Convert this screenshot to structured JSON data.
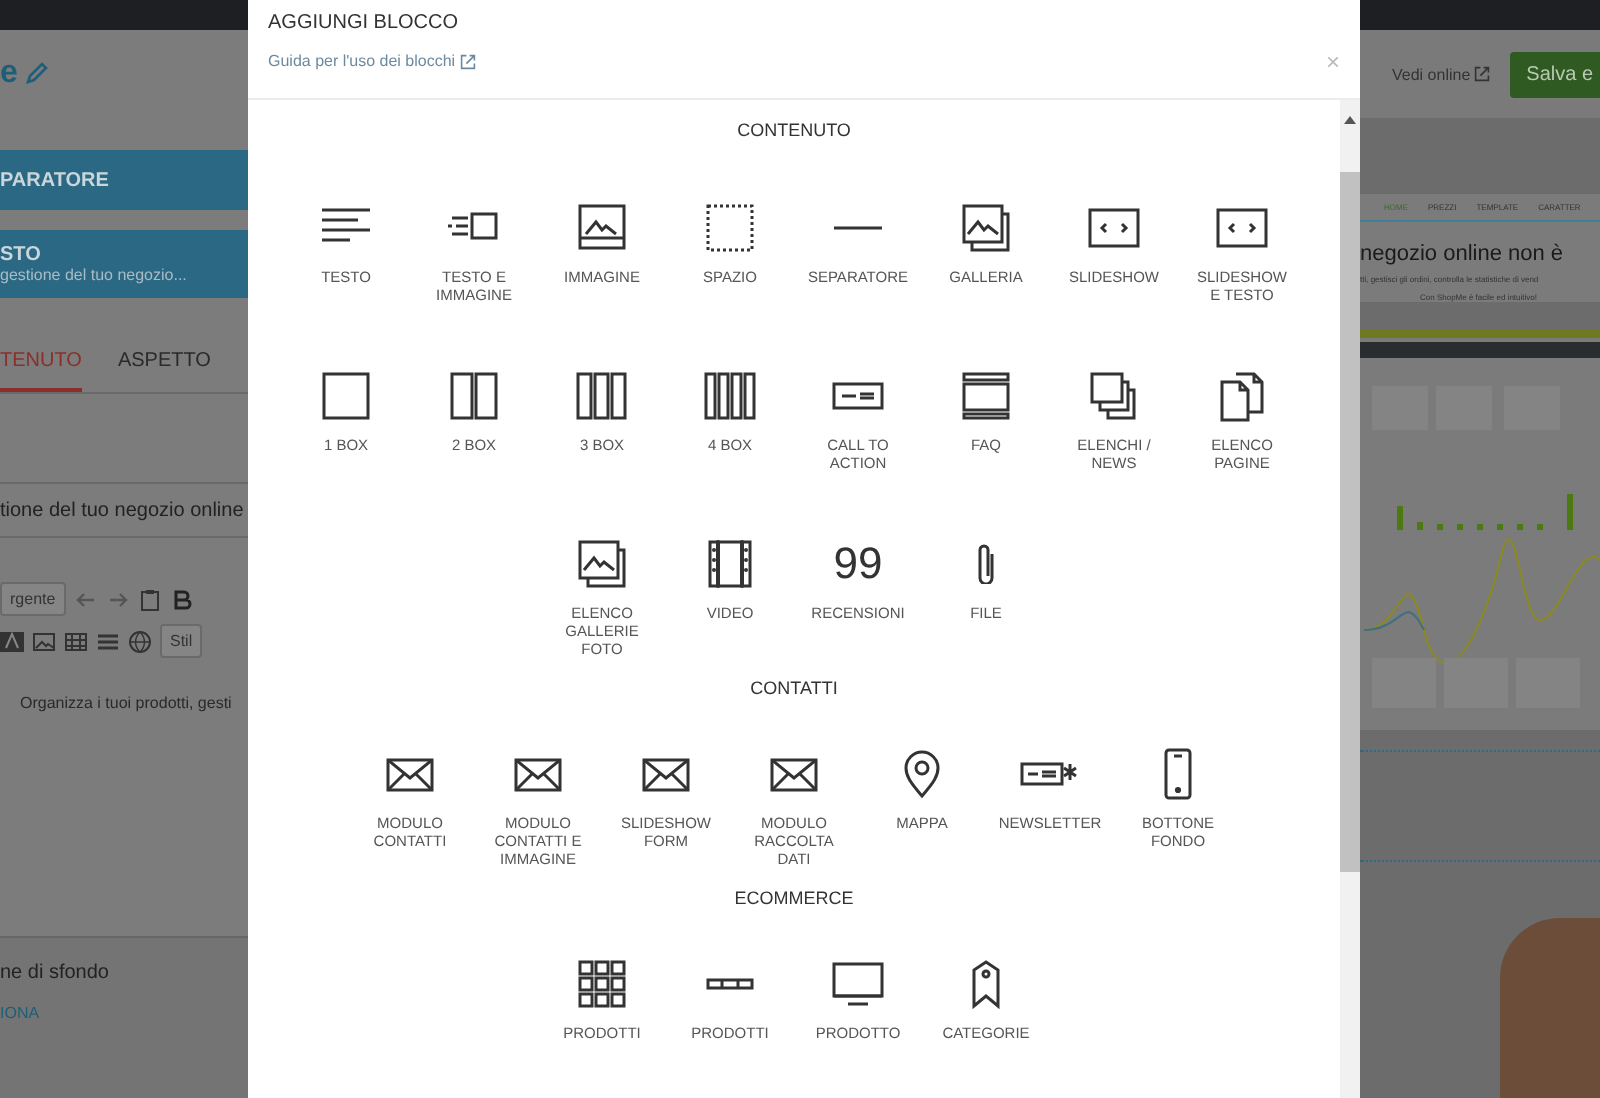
{
  "editor": {
    "title_fragment": "e",
    "blocks": [
      {
        "title": "PARATORE"
      },
      {
        "title": "STO",
        "subtitle": "gestione del tuo negozio..."
      }
    ],
    "tabs": [
      {
        "label": "TENUTO",
        "selected": true
      },
      {
        "label": "ASPETTO",
        "selected": false
      }
    ],
    "title_field": {
      "value": "tione del tuo negozio online"
    },
    "toolbar": {
      "source_button": "rgente",
      "style_select": "Stil"
    },
    "body_text": "Organizza i tuoi prodotti, gesti",
    "background_label": "ne di sfondo",
    "background_link": "IONA"
  },
  "header_actions": {
    "view_online": "Vedi online",
    "save": "Salva e"
  },
  "preview": {
    "nav": [
      "HOME",
      "PREZZI",
      "TEMPLATE",
      "CARATTER"
    ],
    "heading": "negozio online non è",
    "line_1": "tti, gestisci gli ordini, controlla le statistiche di vend",
    "line_2": "Con ShopMe è facile ed intuitivo!"
  },
  "modal": {
    "title": "AGGIUNGI BLOCCO",
    "guide_link": "Guida per l'uso dei blocchi",
    "close": "×",
    "sections": [
      {
        "title": "CONTENUTO",
        "items": [
          {
            "kind": "text",
            "label": "TESTO"
          },
          {
            "kind": "text-image",
            "label": "TESTO E IMMAGINE"
          },
          {
            "kind": "image",
            "label": "IMMAGINE"
          },
          {
            "kind": "space",
            "label": "SPAZIO"
          },
          {
            "kind": "separator",
            "label": "SEPARATORE"
          },
          {
            "kind": "gallery",
            "label": "GALLERIA"
          },
          {
            "kind": "slideshow",
            "label": "SLIDESHOW"
          },
          {
            "kind": "slideshow",
            "label": "SLIDESHOW E TESTO"
          },
          {
            "kind": "box1",
            "label": "1 BOX"
          },
          {
            "kind": "box2",
            "label": "2 BOX"
          },
          {
            "kind": "box3",
            "label": "3 BOX"
          },
          {
            "kind": "box4",
            "label": "4 BOX"
          },
          {
            "kind": "cta",
            "label": "CALL TO ACTION"
          },
          {
            "kind": "faq",
            "label": "FAQ"
          },
          {
            "kind": "list",
            "label": "ELENCHI / NEWS"
          },
          {
            "kind": "pages",
            "label": "ELENCO PAGINE"
          },
          {
            "kind": "gallery",
            "label": "ELENCO GALLERIE FOTO"
          },
          {
            "kind": "video",
            "label": "VIDEO"
          },
          {
            "kind": "quote",
            "symbol": "99",
            "label": "RECENSIONI"
          },
          {
            "kind": "file",
            "label": "FILE"
          }
        ]
      },
      {
        "title": "CONTATTI",
        "items": [
          {
            "kind": "envelope",
            "label": "MODULO CONTATTI"
          },
          {
            "kind": "envelope",
            "label": "MODULO CONTATTI E IMMAGINE"
          },
          {
            "kind": "envelope",
            "label": "SLIDESHOW FORM"
          },
          {
            "kind": "envelope",
            "label": "MODULO RACCOLTA DATI"
          },
          {
            "kind": "map",
            "label": "MAPPA"
          },
          {
            "kind": "newsletter",
            "label": "NEWSLETTER"
          },
          {
            "kind": "phone",
            "label": "BOTTONE FONDO"
          }
        ]
      },
      {
        "title": "ECOMMERCE",
        "items": [
          {
            "kind": "grid",
            "label": "PRODOTTI"
          },
          {
            "kind": "bar",
            "label": "PRODOTTI"
          },
          {
            "kind": "monitor",
            "label": "PRODOTTO"
          },
          {
            "kind": "tag",
            "label": "CATEGORIE"
          }
        ]
      }
    ]
  }
}
